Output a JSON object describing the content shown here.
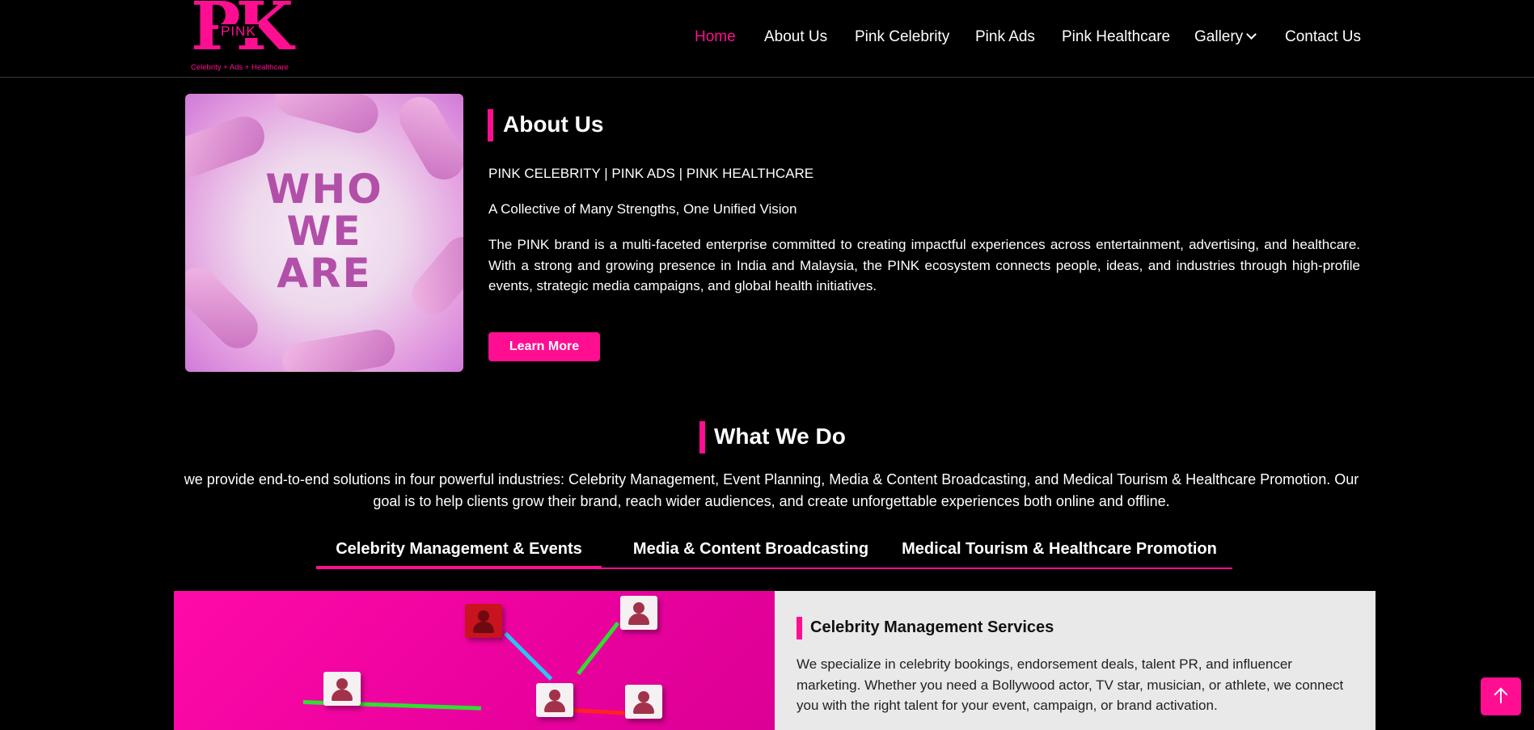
{
  "logo": {
    "letters": "PK",
    "word": "PINK",
    "tagline": "Celebrity + Ads + Healthcare"
  },
  "nav": {
    "items": [
      {
        "label": "Home",
        "active": true
      },
      {
        "label": "About Us",
        "active": false
      },
      {
        "label": "Pink Celebrity",
        "active": false
      },
      {
        "label": "Pink Ads",
        "active": false
      },
      {
        "label": "Pink Healthcare",
        "active": false
      },
      {
        "label": "Gallery",
        "active": false,
        "has_dropdown": true
      },
      {
        "label": "Contact Us",
        "active": false
      }
    ]
  },
  "about": {
    "image_text": [
      "WHO",
      "WE",
      "ARE"
    ],
    "title": "About Us",
    "line1": "PINK CELEBRITY | PINK ADS | PINK HEALTHCARE",
    "line2": "A Collective of Many Strengths, One Unified Vision",
    "paragraph": "The PINK brand is a multi-faceted enterprise committed to creating impactful experiences across entertainment, advertising, and healthcare. With a strong and growing presence in India and Malaysia, the PINK ecosystem connects people, ideas, and industries through high-profile events, strategic media campaigns, and global health initiatives.",
    "button": "Learn More"
  },
  "what_we_do": {
    "title": "What We Do",
    "text": "we provide end-to-end solutions in four powerful industries: Celebrity Management, Event Planning, Media & Content Broadcasting, and Medical Tourism & Healthcare Promotion. Our goal is to help clients grow their brand, reach wider audiences, and create unforgettable experiences both online and offline.",
    "tabs": [
      {
        "label": "Celebrity Management & Events",
        "active": true
      },
      {
        "label": "Media & Content Broadcasting",
        "active": false
      },
      {
        "label": "Medical Tourism & Healthcare Promotion",
        "active": false
      }
    ]
  },
  "card": {
    "title": "Celebrity Management Services",
    "text": "We specialize in celebrity bookings, endorsement deals, talent PR, and influencer marketing. Whether you need a Bollywood actor, TV star, musician, or athlete, we connect you with the right talent for your event, campaign, or brand activation."
  },
  "colors": {
    "accent": "#ff0e92",
    "background": "#000000",
    "card_bg": "#e9e9e9"
  },
  "icons": {
    "scroll_top": "arrow-up-icon",
    "dropdown": "chevron-down-icon"
  }
}
